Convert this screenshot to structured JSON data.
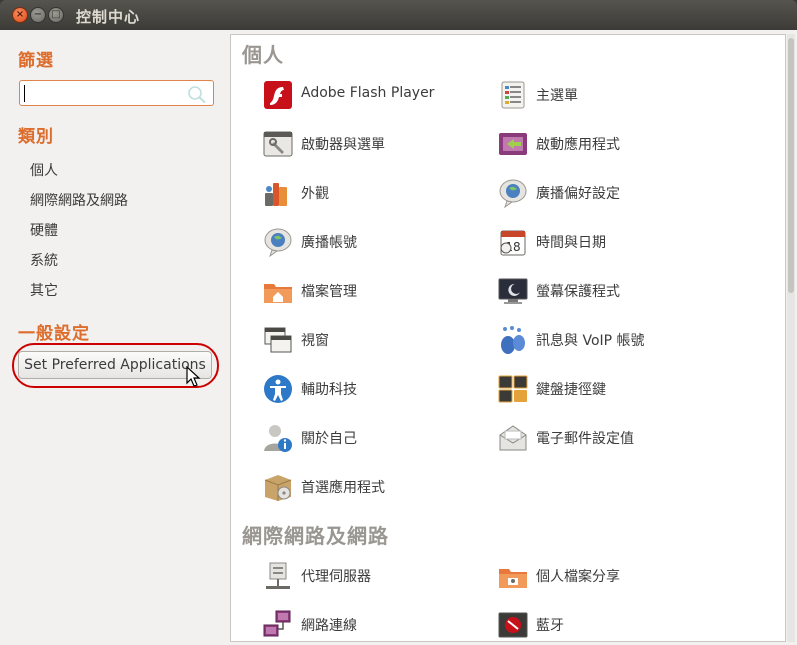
{
  "window": {
    "title": "控制中心"
  },
  "sidebar": {
    "filter_heading": "篩選",
    "search": {
      "value": "",
      "placeholder": ""
    },
    "category_heading": "類別",
    "categories": [
      "個人",
      "網際網路及網路",
      "硬體",
      "系統",
      "其它"
    ],
    "general_heading": "一般設定",
    "preferred_apps_button": "Set Preferred Applications"
  },
  "sections": [
    {
      "title": "個人",
      "items": [
        {
          "label": "Adobe Flash Player",
          "icon": "flash-player-icon"
        },
        {
          "label": "主選單",
          "icon": "main-menu-icon"
        },
        {
          "label": "啟動器與選單",
          "icon": "launcher-icon"
        },
        {
          "label": "啟動應用程式",
          "icon": "startup-apps-icon"
        },
        {
          "label": "外觀",
          "icon": "appearance-icon"
        },
        {
          "label": "廣播偏好設定",
          "icon": "broadcast-prefs-icon"
        },
        {
          "label": "廣播帳號",
          "icon": "broadcast-accounts-icon"
        },
        {
          "label": "時間與日期",
          "icon": "calendar-icon"
        },
        {
          "label": "檔案管理",
          "icon": "file-manager-icon"
        },
        {
          "label": "螢幕保護程式",
          "icon": "screensaver-icon"
        },
        {
          "label": "視窗",
          "icon": "windows-icon"
        },
        {
          "label": "訊息與 VoIP 帳號",
          "icon": "messaging-icon"
        },
        {
          "label": "輔助科技",
          "icon": "accessibility-icon"
        },
        {
          "label": "鍵盤捷徑鍵",
          "icon": "keyboard-shortcuts-icon"
        },
        {
          "label": "關於自己",
          "icon": "about-me-icon"
        },
        {
          "label": "電子郵件設定值",
          "icon": "email-settings-icon"
        },
        {
          "label": "首選應用程式",
          "icon": "preferred-apps-icon"
        }
      ]
    },
    {
      "title": "網際網路及網路",
      "items": [
        {
          "label": "代理伺服器",
          "icon": "proxy-icon"
        },
        {
          "label": "個人檔案分享",
          "icon": "file-sharing-icon"
        },
        {
          "label": "網路連線",
          "icon": "network-icon"
        },
        {
          "label": "藍牙",
          "icon": "bluetooth-icon"
        }
      ]
    }
  ],
  "colors": {
    "heading_orange": "#dd6d2c",
    "section_grey": "#9a9792",
    "highlight_red": "#cc0000"
  }
}
